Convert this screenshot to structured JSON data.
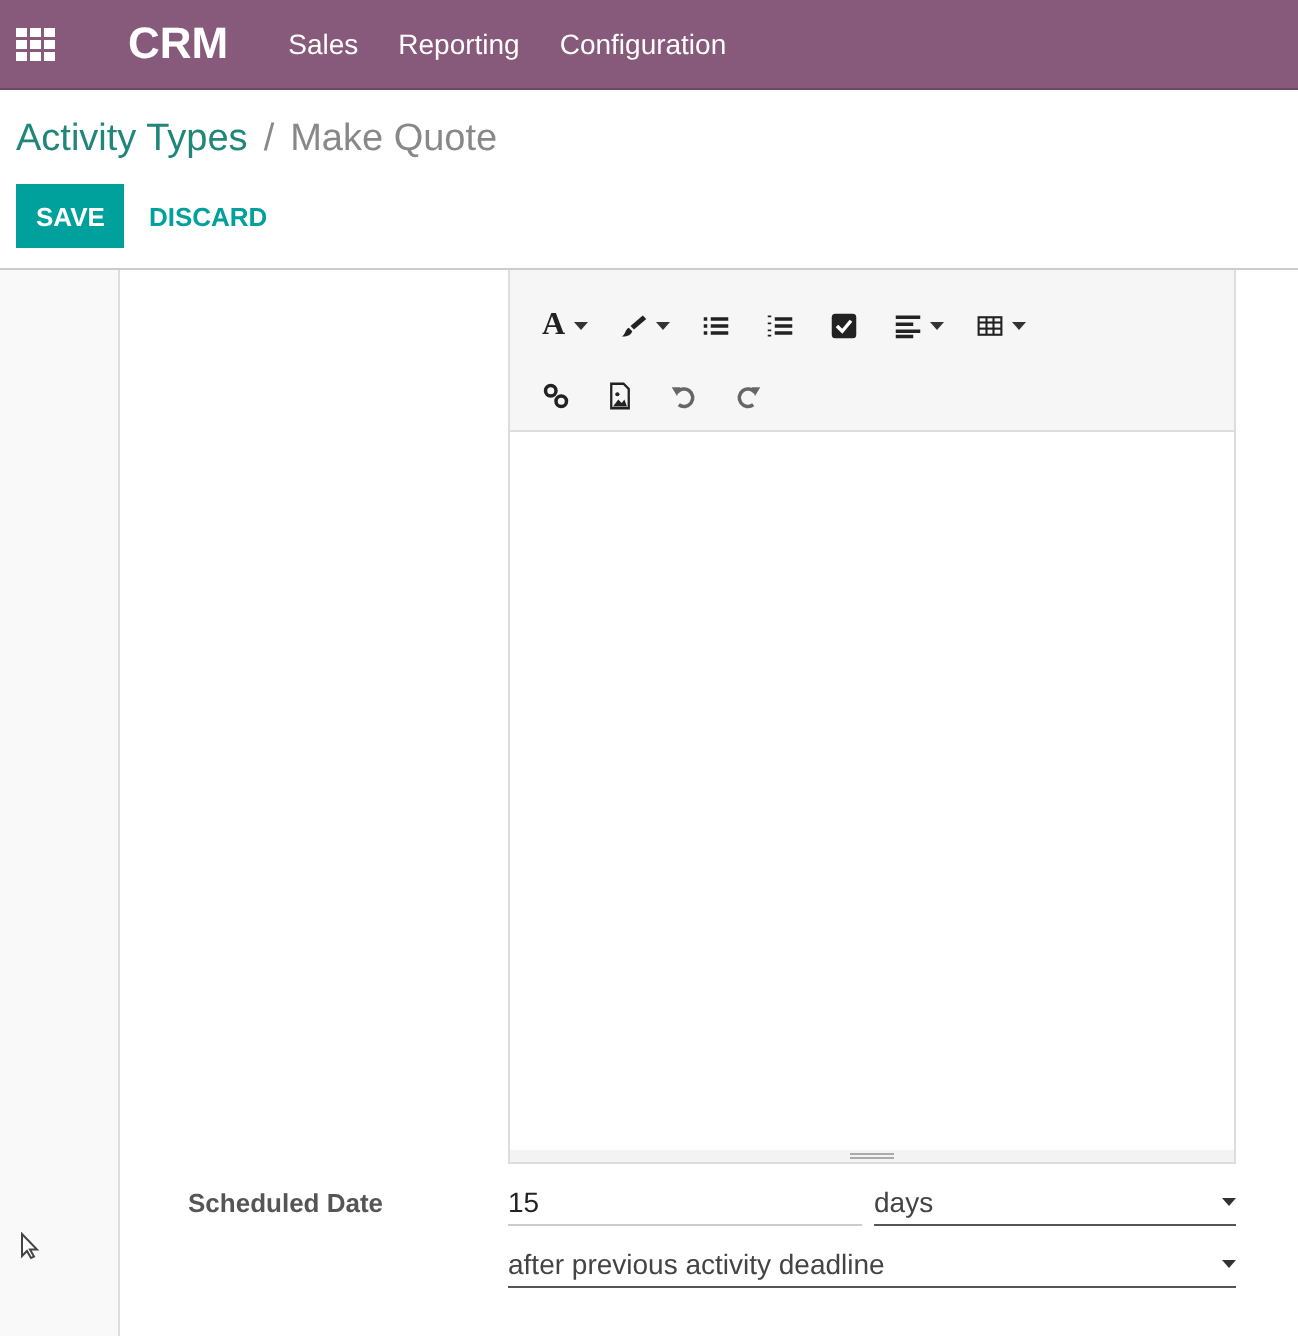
{
  "navbar": {
    "app_name": "CRM",
    "menu": [
      {
        "label": "Sales"
      },
      {
        "label": "Reporting"
      },
      {
        "label": "Configuration"
      }
    ]
  },
  "breadcrumb": {
    "parent": "Activity Types",
    "separator": "/",
    "current": "Make Quote"
  },
  "buttons": [
    {
      "label": "SAVE",
      "kind": "primary"
    },
    {
      "label": "DISCARD",
      "kind": "link"
    }
  ],
  "editor": {
    "toolbar_rows": [
      [
        {
          "kind": "font-color",
          "label": "A",
          "dropdown": true
        },
        {
          "kind": "brush",
          "dropdown": true
        },
        {
          "kind": "bullet-list",
          "dropdown": false
        },
        {
          "kind": "number-list",
          "dropdown": false
        },
        {
          "kind": "checklist",
          "dropdown": false
        },
        {
          "kind": "align",
          "dropdown": true
        },
        {
          "kind": "table",
          "dropdown": true
        }
      ],
      [
        {
          "kind": "link",
          "dropdown": false
        },
        {
          "kind": "image",
          "dropdown": false
        },
        {
          "kind": "undo",
          "dropdown": false
        },
        {
          "kind": "redo",
          "dropdown": false
        }
      ]
    ]
  },
  "scheduled_date": {
    "label": "Scheduled Date",
    "delay": "15",
    "unit": "days",
    "from": "after previous activity deadline"
  }
}
